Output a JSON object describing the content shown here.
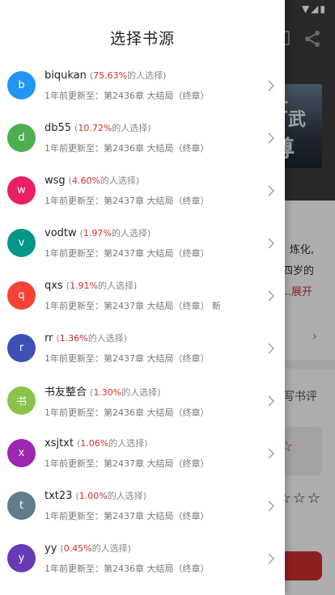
{
  "drawer": {
    "title": "选择书源"
  },
  "sources": [
    {
      "letter": "b",
      "name": "biqukan",
      "pct": "75.63%",
      "suffix": "的人选择)",
      "prefix": "(",
      "update": "1年前更新至：第2436章 大结局（终章）",
      "color": "#2196f3"
    },
    {
      "letter": "d",
      "name": "db55",
      "pct": "10.72%",
      "suffix": "的人选择)",
      "prefix": "(",
      "update": "1年前更新至：第2436章 大结局（终章）",
      "color": "#4caf50"
    },
    {
      "letter": "w",
      "name": "wsg",
      "pct": "4.60%",
      "suffix": "的人选择)",
      "prefix": "(",
      "update": "1年前更新至：第2437章 大结局（终章）",
      "color": "#e91e63"
    },
    {
      "letter": "v",
      "name": "vodtw",
      "pct": "1.97%",
      "suffix": "的人选择)",
      "prefix": "(",
      "update": "1年前更新至：第2437章 大结局（终章）",
      "color": "#009688"
    },
    {
      "letter": "q",
      "name": "qxs",
      "pct": "1.91%",
      "suffix": "的人选择)",
      "prefix": "(",
      "update": "1年前更新至：第2437章 大结局（终章） 新",
      "color": "#f44336"
    },
    {
      "letter": "r",
      "name": "rr",
      "pct": "1.36%",
      "suffix": "的人选择)",
      "prefix": "(",
      "update": "1年前更新至：第2437章 大结局（终章）",
      "color": "#3f51b5"
    },
    {
      "letter": "书",
      "name": "书友整合",
      "pct": "1.30%",
      "suffix": "的人选择)",
      "prefix": "(",
      "update": "1年前更新至：第2436章 大结局（终章）",
      "color": "#8bc34a"
    },
    {
      "letter": "x",
      "name": "xsjtxt",
      "pct": "1.06%",
      "suffix": "的人选择)",
      "prefix": "(",
      "update": "1年前更新至：第2437章 大结局（终章）",
      "color": "#9c27b0"
    },
    {
      "letter": "t",
      "name": "txt23",
      "pct": "1.00%",
      "suffix": "的人选择)",
      "prefix": "(",
      "update": "1年前更新至：第2437章 大结局（终章）",
      "color": "#607d8b"
    },
    {
      "letter": "y",
      "name": "yy",
      "pct": "0.45%",
      "suffix": "的人选择)",
      "prefix": "(",
      "update": "1年前更新至：第2436章 大结局（终章）",
      "color": "#673ab7"
    }
  ],
  "background": {
    "text1": "炼化,",
    "text2": "四岁的",
    "expand": "...展开",
    "review": "写书评",
    "stars": "☆☆☆",
    "star_red": "☆",
    "chevron": "›",
    "status": "▼◢▮",
    "cover_text_1": "仕",
    "cover_text_2": "武",
    "cover_text_3": "尊"
  },
  "colors": {
    "accent": "#d32f2f"
  }
}
